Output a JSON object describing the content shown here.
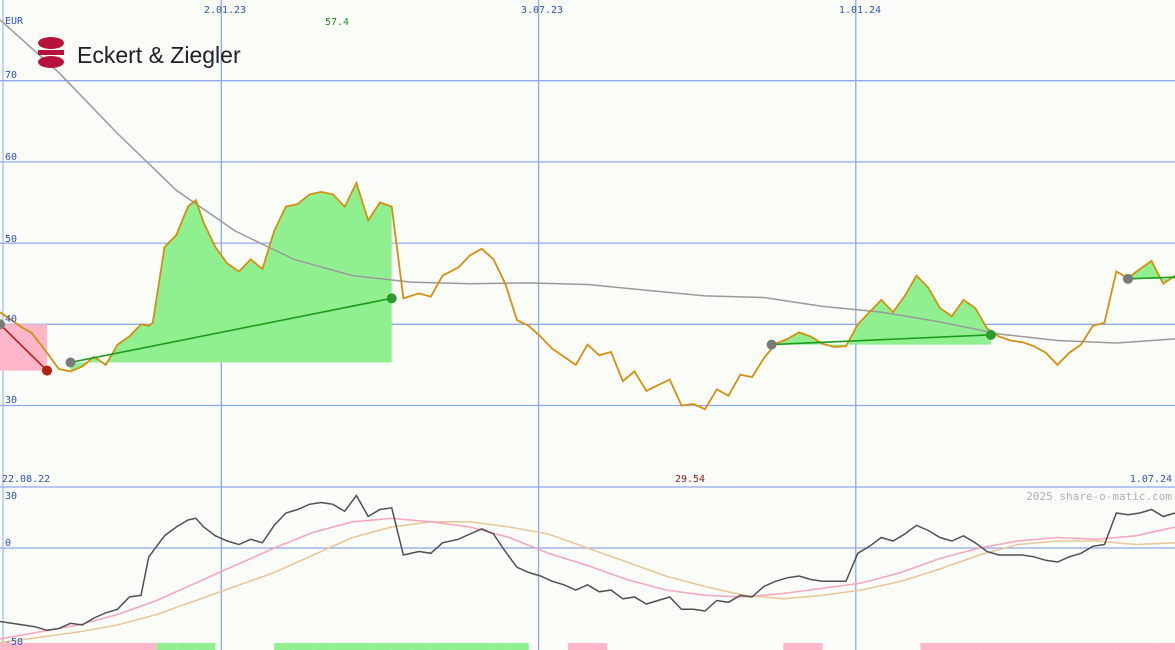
{
  "brand": {
    "company_name": "Eckert & Ziegler",
    "logo_color": "#b5123c",
    "watermark": "2025 share-o-matic.com"
  },
  "chart_data": [
    {
      "type": "line",
      "currency_label": "EUR",
      "x_tick_labels": [
        "2.01.23",
        "3.07.23",
        "1.01.24"
      ],
      "range_start_label": "22.08.22",
      "range_end_label": "1.07.24",
      "max_label": "57.4",
      "min_label": "29.54",
      "y_ticks": [
        30,
        40,
        50,
        60,
        70
      ],
      "ylim": [
        25,
        75
      ],
      "grid": true,
      "colors": {
        "price": "#d4900e",
        "moving_average": "#9a9a9a",
        "gain_fill": "#90f090",
        "loss_fill": "#ffb6c8",
        "gain_trade_line": "#1e9a1e",
        "loss_trade_line": "#c01818",
        "grid": "#8ea8ee",
        "axis_text": "#3050c0"
      },
      "price_series": [
        [
          0,
          41.5
        ],
        [
          6,
          39.5
        ],
        [
          8,
          39.0
        ],
        [
          12,
          36.5
        ],
        [
          15,
          34.5
        ],
        [
          18,
          34.2
        ],
        [
          21,
          34.8
        ],
        [
          24,
          36.0
        ],
        [
          27,
          35.0
        ],
        [
          30,
          37.5
        ],
        [
          33,
          38.5
        ],
        [
          36,
          40.0
        ],
        [
          38,
          39.8
        ],
        [
          39,
          40.2
        ],
        [
          42,
          49.5
        ],
        [
          45,
          51.0
        ],
        [
          48,
          54.5
        ],
        [
          50,
          55.3
        ],
        [
          52,
          52.5
        ],
        [
          55,
          49.5
        ],
        [
          58,
          47.5
        ],
        [
          61,
          46.5
        ],
        [
          64,
          48.0
        ],
        [
          67,
          46.8
        ],
        [
          70,
          51.5
        ],
        [
          73,
          54.5
        ],
        [
          76,
          54.8
        ],
        [
          79,
          56.0
        ],
        [
          82,
          56.3
        ],
        [
          85,
          56.0
        ],
        [
          88,
          54.5
        ],
        [
          91,
          57.4
        ],
        [
          94,
          52.8
        ],
        [
          97,
          55.0
        ],
        [
          100,
          54.5
        ],
        [
          103,
          43.2
        ],
        [
          107,
          43.8
        ],
        [
          110,
          43.4
        ],
        [
          113,
          46.0
        ],
        [
          117,
          47.0
        ],
        [
          120,
          48.5
        ],
        [
          123,
          49.3
        ],
        [
          126,
          48.0
        ],
        [
          129,
          45.0
        ],
        [
          132,
          40.5
        ],
        [
          135,
          39.8
        ],
        [
          138,
          38.5
        ],
        [
          141,
          37.0
        ],
        [
          144,
          36.0
        ],
        [
          147,
          35.0
        ],
        [
          150,
          37.5
        ],
        [
          153,
          36.2
        ],
        [
          156,
          36.6
        ],
        [
          159,
          33.0
        ],
        [
          162,
          34.2
        ],
        [
          165,
          31.8
        ],
        [
          168,
          32.5
        ],
        [
          171,
          33.2
        ],
        [
          174,
          30.0
        ],
        [
          177,
          30.2
        ],
        [
          180,
          29.54
        ],
        [
          183,
          32.0
        ],
        [
          186,
          31.2
        ],
        [
          189,
          33.8
        ],
        [
          192,
          33.5
        ],
        [
          195,
          35.8
        ],
        [
          198,
          37.6
        ],
        [
          201,
          38.2
        ],
        [
          204,
          39.0
        ],
        [
          207,
          38.5
        ],
        [
          210,
          37.6
        ],
        [
          213,
          37.2
        ],
        [
          216,
          37.3
        ],
        [
          219,
          40.0
        ],
        [
          222,
          41.5
        ],
        [
          225,
          43.0
        ],
        [
          228,
          41.5
        ],
        [
          231,
          43.5
        ],
        [
          234,
          46.0
        ],
        [
          237,
          44.5
        ],
        [
          240,
          42.0
        ],
        [
          243,
          41.0
        ],
        [
          246,
          43.0
        ],
        [
          249,
          42.0
        ],
        [
          252,
          39.5
        ],
        [
          255,
          38.5
        ],
        [
          258,
          38.0
        ],
        [
          261,
          37.8
        ],
        [
          264,
          37.3
        ],
        [
          267,
          36.5
        ],
        [
          270,
          35.0
        ],
        [
          273,
          36.5
        ],
        [
          276,
          37.5
        ],
        [
          279,
          39.8
        ],
        [
          282,
          40.2
        ],
        [
          285,
          46.5
        ],
        [
          288,
          45.7
        ],
        [
          291,
          46.8
        ],
        [
          294,
          47.8
        ],
        [
          297,
          45.0
        ],
        [
          300,
          46.0
        ]
      ],
      "moving_average_series": [
        [
          0,
          77.5
        ],
        [
          15,
          71.0
        ],
        [
          30,
          63.5
        ],
        [
          45,
          56.5
        ],
        [
          60,
          51.5
        ],
        [
          75,
          48.0
        ],
        [
          90,
          46.0
        ],
        [
          105,
          45.2
        ],
        [
          120,
          45.0
        ],
        [
          135,
          45.1
        ],
        [
          150,
          44.9
        ],
        [
          165,
          44.2
        ],
        [
          180,
          43.5
        ],
        [
          195,
          43.3
        ],
        [
          210,
          42.2
        ],
        [
          225,
          41.5
        ],
        [
          240,
          40.3
        ],
        [
          255,
          38.8
        ],
        [
          270,
          38.0
        ],
        [
          285,
          37.7
        ],
        [
          300,
          38.2
        ]
      ],
      "trades": [
        {
          "result": "loss",
          "start": [
            0,
            40.0
          ],
          "end": [
            12,
            34.3
          ]
        },
        {
          "result": "gain",
          "start": [
            18,
            35.3
          ],
          "end": [
            100,
            43.2
          ]
        },
        {
          "result": "gain",
          "start": [
            197,
            37.5
          ],
          "end": [
            253,
            38.7
          ]
        },
        {
          "result": "gain",
          "start": [
            288,
            45.6
          ],
          "end": [
            300,
            45.8
          ]
        }
      ]
    },
    {
      "type": "line",
      "y_ticks": [
        30,
        0,
        -50
      ],
      "ylim": [
        -55,
        35
      ],
      "colors": {
        "oscillator": "#505050",
        "signal_fast": "#f4a8c0",
        "signal_slow": "#e8c89a",
        "positive_bar": "#90f090",
        "negative_bar": "#ffb6c8"
      },
      "oscillator_series": [
        [
          0,
          -42
        ],
        [
          6,
          -44
        ],
        [
          9,
          -45
        ],
        [
          12,
          -47
        ],
        [
          15,
          -46
        ],
        [
          18,
          -43
        ],
        [
          21,
          -44
        ],
        [
          24,
          -40
        ],
        [
          27,
          -37
        ],
        [
          30,
          -35
        ],
        [
          33,
          -28
        ],
        [
          36,
          -27
        ],
        [
          38,
          -5
        ],
        [
          42,
          7
        ],
        [
          45,
          12
        ],
        [
          48,
          16
        ],
        [
          50,
          17
        ],
        [
          52,
          12
        ],
        [
          55,
          7
        ],
        [
          58,
          4
        ],
        [
          61,
          2
        ],
        [
          64,
          5
        ],
        [
          67,
          3
        ],
        [
          70,
          13
        ],
        [
          73,
          20
        ],
        [
          76,
          22
        ],
        [
          79,
          25
        ],
        [
          82,
          26
        ],
        [
          85,
          25
        ],
        [
          88,
          21
        ],
        [
          91,
          30
        ],
        [
          94,
          18
        ],
        [
          97,
          22
        ],
        [
          100,
          23
        ],
        [
          103,
          -4
        ],
        [
          107,
          -2
        ],
        [
          110,
          -3
        ],
        [
          113,
          3
        ],
        [
          117,
          5
        ],
        [
          120,
          8
        ],
        [
          123,
          11
        ],
        [
          126,
          8
        ],
        [
          129,
          -2
        ],
        [
          132,
          -11
        ],
        [
          135,
          -14
        ],
        [
          138,
          -16
        ],
        [
          141,
          -19
        ],
        [
          144,
          -21
        ],
        [
          147,
          -24
        ],
        [
          150,
          -21
        ],
        [
          153,
          -25
        ],
        [
          156,
          -24
        ],
        [
          159,
          -29
        ],
        [
          162,
          -28
        ],
        [
          165,
          -32
        ],
        [
          168,
          -30
        ],
        [
          171,
          -28
        ],
        [
          174,
          -35
        ],
        [
          177,
          -35
        ],
        [
          180,
          -36
        ],
        [
          183,
          -30
        ],
        [
          186,
          -31
        ],
        [
          189,
          -27
        ],
        [
          192,
          -28
        ],
        [
          195,
          -22
        ],
        [
          198,
          -19
        ],
        [
          201,
          -17
        ],
        [
          204,
          -16
        ],
        [
          207,
          -18
        ],
        [
          210,
          -19
        ],
        [
          213,
          -19
        ],
        [
          216,
          -19
        ],
        [
          219,
          -3
        ],
        [
          222,
          1
        ],
        [
          225,
          6
        ],
        [
          228,
          4
        ],
        [
          231,
          8
        ],
        [
          234,
          13
        ],
        [
          237,
          10
        ],
        [
          240,
          6
        ],
        [
          243,
          4
        ],
        [
          246,
          7
        ],
        [
          249,
          3
        ],
        [
          252,
          -2
        ],
        [
          255,
          -4
        ],
        [
          258,
          -4
        ],
        [
          261,
          -4
        ],
        [
          264,
          -5
        ],
        [
          267,
          -7
        ],
        [
          270,
          -8
        ],
        [
          273,
          -5
        ],
        [
          276,
          -3
        ],
        [
          279,
          1
        ],
        [
          282,
          2
        ],
        [
          285,
          20
        ],
        [
          288,
          19
        ],
        [
          291,
          20
        ],
        [
          294,
          22
        ],
        [
          297,
          18
        ],
        [
          300,
          20
        ]
      ],
      "signal_fast_series": [
        [
          0,
          -52
        ],
        [
          10,
          -48
        ],
        [
          20,
          -44
        ],
        [
          30,
          -38
        ],
        [
          40,
          -30
        ],
        [
          50,
          -20
        ],
        [
          60,
          -10
        ],
        [
          70,
          0
        ],
        [
          80,
          9
        ],
        [
          90,
          15
        ],
        [
          100,
          17
        ],
        [
          110,
          15
        ],
        [
          120,
          12
        ],
        [
          130,
          6
        ],
        [
          140,
          -3
        ],
        [
          150,
          -10
        ],
        [
          160,
          -18
        ],
        [
          170,
          -24
        ],
        [
          180,
          -27
        ],
        [
          190,
          -28
        ],
        [
          200,
          -26
        ],
        [
          210,
          -23
        ],
        [
          220,
          -20
        ],
        [
          230,
          -14
        ],
        [
          240,
          -6
        ],
        [
          250,
          0
        ],
        [
          260,
          4
        ],
        [
          270,
          6
        ],
        [
          280,
          5
        ],
        [
          290,
          7
        ],
        [
          300,
          12
        ]
      ],
      "signal_slow_series": [
        [
          0,
          -54
        ],
        [
          10,
          -51
        ],
        [
          20,
          -48
        ],
        [
          30,
          -44
        ],
        [
          40,
          -38
        ],
        [
          50,
          -30
        ],
        [
          60,
          -22
        ],
        [
          70,
          -14
        ],
        [
          80,
          -4
        ],
        [
          90,
          6
        ],
        [
          100,
          12
        ],
        [
          110,
          15
        ],
        [
          120,
          15
        ],
        [
          130,
          12
        ],
        [
          140,
          8
        ],
        [
          150,
          0
        ],
        [
          160,
          -8
        ],
        [
          170,
          -16
        ],
        [
          180,
          -22
        ],
        [
          190,
          -27
        ],
        [
          200,
          -29
        ],
        [
          210,
          -27
        ],
        [
          220,
          -24
        ],
        [
          230,
          -19
        ],
        [
          240,
          -12
        ],
        [
          250,
          -4
        ],
        [
          260,
          2
        ],
        [
          270,
          4
        ],
        [
          280,
          4
        ],
        [
          290,
          2
        ],
        [
          300,
          3
        ]
      ],
      "histogram_bars": [
        [
          0,
          -1
        ],
        [
          5,
          -1
        ],
        [
          10,
          -1
        ],
        [
          15,
          -1
        ],
        [
          20,
          -1
        ],
        [
          25,
          -1
        ],
        [
          30,
          -1
        ],
        [
          35,
          -1
        ],
        [
          40,
          1
        ],
        [
          45,
          1
        ],
        [
          50,
          1
        ],
        [
          55,
          0
        ],
        [
          60,
          0
        ],
        [
          65,
          0
        ],
        [
          70,
          1
        ],
        [
          75,
          1
        ],
        [
          80,
          1
        ],
        [
          85,
          1
        ],
        [
          90,
          1
        ],
        [
          95,
          1
        ],
        [
          100,
          1
        ],
        [
          105,
          1
        ],
        [
          110,
          1
        ],
        [
          115,
          1
        ],
        [
          120,
          1
        ],
        [
          125,
          1
        ],
        [
          130,
          1
        ],
        [
          135,
          0
        ],
        [
          140,
          0
        ],
        [
          145,
          -1
        ],
        [
          150,
          -1
        ],
        [
          155,
          0
        ],
        [
          160,
          0
        ],
        [
          165,
          0
        ],
        [
          170,
          0
        ],
        [
          175,
          0
        ],
        [
          180,
          0
        ],
        [
          185,
          0
        ],
        [
          190,
          0
        ],
        [
          195,
          0
        ],
        [
          200,
          -1
        ],
        [
          205,
          -1
        ],
        [
          210,
          0
        ],
        [
          215,
          0
        ],
        [
          220,
          0
        ],
        [
          225,
          0
        ],
        [
          230,
          0
        ],
        [
          235,
          -1
        ],
        [
          240,
          -1
        ],
        [
          245,
          -1
        ],
        [
          250,
          -1
        ],
        [
          255,
          -1
        ],
        [
          260,
          -1
        ],
        [
          265,
          -1
        ],
        [
          270,
          -1
        ],
        [
          275,
          -1
        ],
        [
          280,
          -1
        ],
        [
          285,
          -1
        ],
        [
          290,
          -1
        ],
        [
          295,
          -1
        ]
      ]
    }
  ]
}
